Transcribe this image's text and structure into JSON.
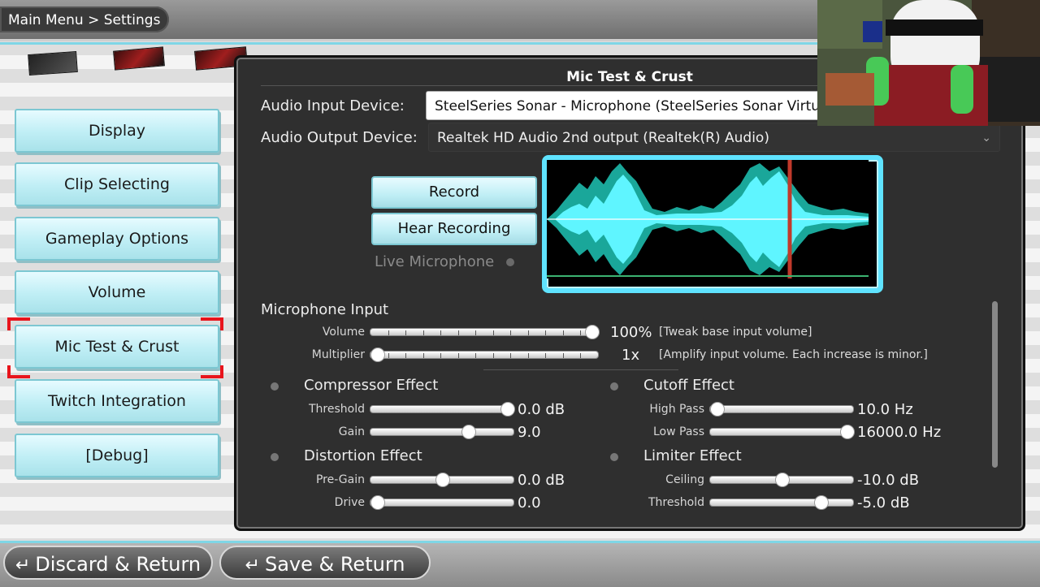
{
  "breadcrumb": "Main Menu > Settings",
  "menu": {
    "items": [
      {
        "label": "Display"
      },
      {
        "label": "Clip Selecting"
      },
      {
        "label": "Gameplay Options"
      },
      {
        "label": "Volume"
      },
      {
        "label": "Mic Test & Crust"
      },
      {
        "label": "Twitch Integration"
      },
      {
        "label": "[Debug]"
      }
    ],
    "selected": "Mic Test & Crust"
  },
  "panel": {
    "title": "Mic Test & Crust",
    "audio_input_label": "Audio Input Device:",
    "audio_input_value": "SteelSeries Sonar - Microphone (SteelSeries Sonar Virtu",
    "audio_output_label": "Audio Output Device:",
    "audio_output_value": "Realtek HD Audio 2nd output (Realtek(R) Audio)",
    "record_label": "Record",
    "hear_label": "Hear Recording",
    "live_mic_label": "Live Microphone",
    "mic_input": {
      "heading": "Microphone Input",
      "volume_label": "Volume",
      "volume_value": "100%",
      "volume_level": 1.0,
      "volume_hint": "[Tweak base input volume]",
      "multiplier_label": "Multiplier",
      "multiplier_value": "1x",
      "multiplier_level": 0.0,
      "multiplier_hint": "[Amplify input volume. Each increase is minor.]"
    },
    "compressor": {
      "heading": "Compressor Effect",
      "threshold_label": "Threshold",
      "threshold_value": "0.0 dB",
      "threshold_level": 1.0,
      "gain_label": "Gain",
      "gain_value": "9.0",
      "gain_level": 0.7
    },
    "cutoff": {
      "heading": "Cutoff Effect",
      "highpass_label": "High Pass",
      "highpass_value": "10.0 Hz",
      "highpass_level": 0.0,
      "lowpass_label": "Low Pass",
      "lowpass_value": "16000.0 Hz",
      "lowpass_level": 1.0
    },
    "distortion": {
      "heading": "Distortion Effect",
      "pregain_label": "Pre-Gain",
      "pregain_value": "0.0 dB",
      "pregain_level": 0.5,
      "drive_label": "Drive",
      "drive_value": "0.0",
      "drive_level": 0.0
    },
    "limiter": {
      "heading": "Limiter Effect",
      "ceiling_label": "Ceiling",
      "ceiling_value": "-10.0 dB",
      "ceiling_level": 0.5,
      "threshold_label": "Threshold",
      "threshold_value": "-5.0 dB",
      "threshold_level": 0.8
    }
  },
  "footer": {
    "discard_label": "Discard & Return",
    "save_label": "Save & Return"
  },
  "colors": {
    "accent_cyan": "#5fe3ff",
    "menu_button": "#bfeef5",
    "selection_red": "#e8141c",
    "panel_bg": "#2f2f2f",
    "waveform_dark": "#1aa79a",
    "waveform_light": "#5ff5ff",
    "playhead": "#c0392b"
  },
  "icons": {
    "back_arrow": "return-arrow-icon",
    "dropdown": "chevron-down-icon"
  }
}
